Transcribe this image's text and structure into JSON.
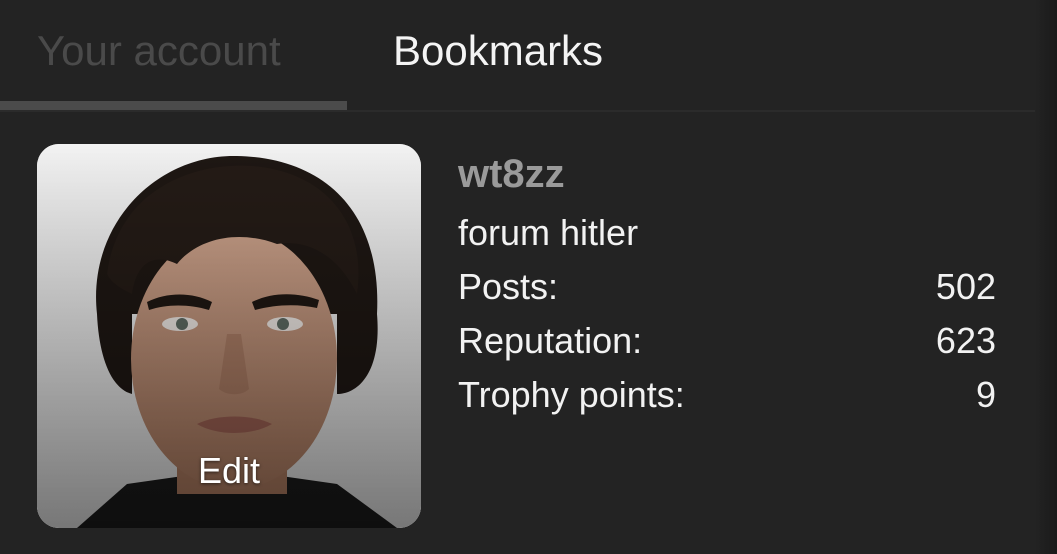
{
  "tabs": [
    {
      "label": "Your account",
      "active": true
    },
    {
      "label": "Bookmarks",
      "active": false
    }
  ],
  "profile": {
    "username": "wt8zz",
    "title": "forum hitler",
    "avatar_edit_label": "Edit",
    "stats": [
      {
        "label": "Posts:",
        "value": "502"
      },
      {
        "label": "Reputation:",
        "value": "623"
      },
      {
        "label": "Trophy points:",
        "value": "9"
      }
    ]
  },
  "colors": {
    "background": "#232323",
    "inactive_tab_text": "#4a4a4a",
    "active_tab_text": "#f4f4f4",
    "username": "#9a9a9a",
    "tab_indicator": "#4b4b4b"
  }
}
